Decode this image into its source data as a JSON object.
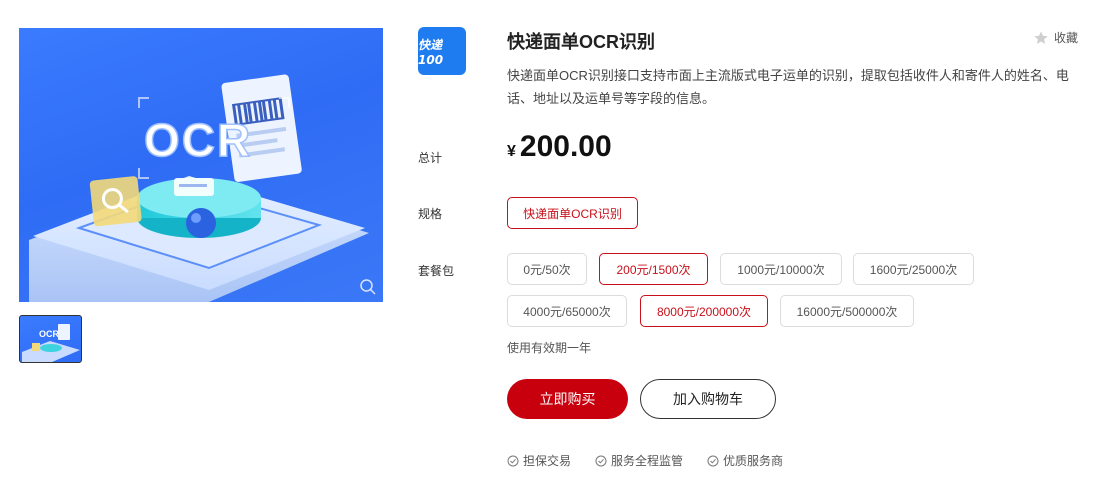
{
  "product": {
    "logo_text": "快递100",
    "title": "快递面单OCR识别",
    "favorite_label": "收藏",
    "description": "快递面单OCR识别接口支持市面上主流版式电子运单的识别，提取包括收件人和寄件人的姓名、电话、地址以及运单号等字段的信息。"
  },
  "image": {
    "ocr_text": "OCR"
  },
  "price": {
    "label": "总计",
    "currency": "¥",
    "amount": "200.00"
  },
  "spec": {
    "label": "规格",
    "options": [
      "快递面单OCR识别"
    ],
    "selected": 0
  },
  "package": {
    "label": "套餐包",
    "options": [
      "0元/50次",
      "200元/1500次",
      "1000元/10000次",
      "1600元/25000次",
      "4000元/65000次",
      "8000元/200000次",
      "16000元/500000次"
    ],
    "selected_indices": [
      1,
      5
    ],
    "validity": "使用有效期一年"
  },
  "actions": {
    "buy_label": "立即购买",
    "cart_label": "加入购物车"
  },
  "guarantees": [
    "担保交易",
    "服务全程监管",
    "优质服务商"
  ],
  "colors": {
    "accent": "#c8000d",
    "logo_bg": "#1f7cf0",
    "image_bg": "#3a7bff"
  }
}
